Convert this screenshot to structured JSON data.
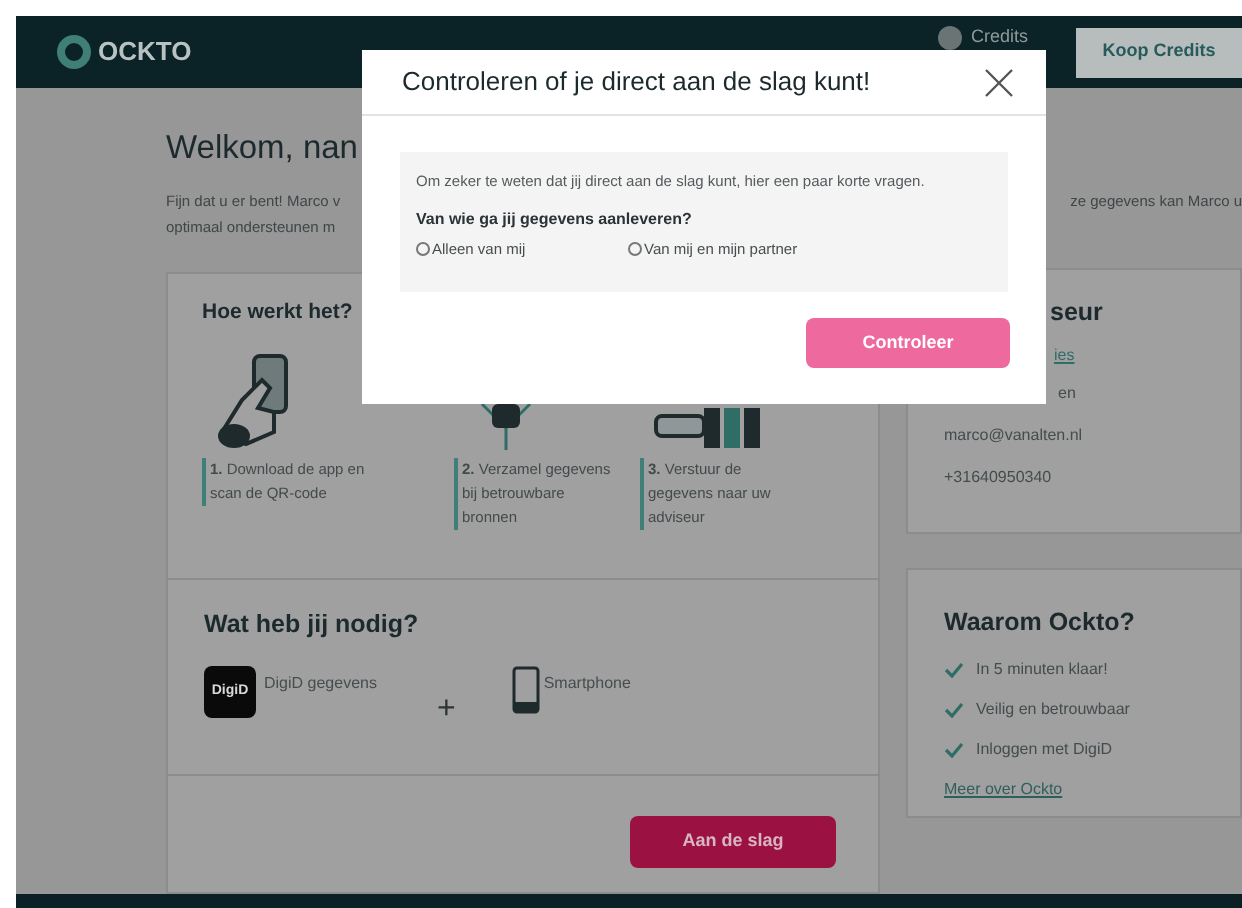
{
  "header": {
    "logo": "OCKTO",
    "credits": "Credits",
    "buy_button": "Koop Credits"
  },
  "welcome": {
    "title": "Welkom, nan",
    "intro_left": [
      "Fijn dat u er bent! Marco v",
      "optimaal ondersteunen m"
    ],
    "intro_right": "ze gegevens kan Marco u"
  },
  "how_it_works": {
    "title": "Hoe werkt het?",
    "steps": [
      {
        "kind": "hand",
        "text": "**1.** Download de app en scan de QR-code"
      },
      {
        "kind": "collect",
        "text": "**2.** Verzamel gegevens bij betrouwbare bronnen"
      },
      {
        "kind": "send",
        "text": "**3.** Verstuur de gegevens naar uw adviseur"
      }
    ]
  },
  "needs": {
    "title": "Wat heb jij nodig?",
    "items": [
      {
        "kind": "digid",
        "logo": "DigiD",
        "label": "DigiD gegevens"
      },
      {
        "kind": "plus",
        "symbol": "+"
      },
      {
        "kind": "phone",
        "label": "Smartphone"
      }
    ]
  },
  "start_button": "Aan de slag",
  "adviser": {
    "title": "seur",
    "link": "ies",
    "name": "en",
    "email": "marco@vanalten.nl",
    "phone": "+31640950340"
  },
  "why": {
    "title": "Waarom Ockto?",
    "points": [
      "In 5 minuten klaar!",
      "Veilig en betrouwbaar",
      "Inloggen met DigiD"
    ],
    "link": "Meer over Ockto"
  },
  "modal": {
    "title": "Controleren of je direct aan de slag kunt!",
    "intro": "Om zeker te weten dat jij direct aan de slag kunt, hier een paar korte vragen.",
    "question": "Van wie ga jij gegevens aanleveren?",
    "options": [
      {
        "label": "Alleen van mij",
        "selected": false
      },
      {
        "label": "Van mij en mijn partner",
        "selected": false
      }
    ],
    "button": "Controleer"
  }
}
